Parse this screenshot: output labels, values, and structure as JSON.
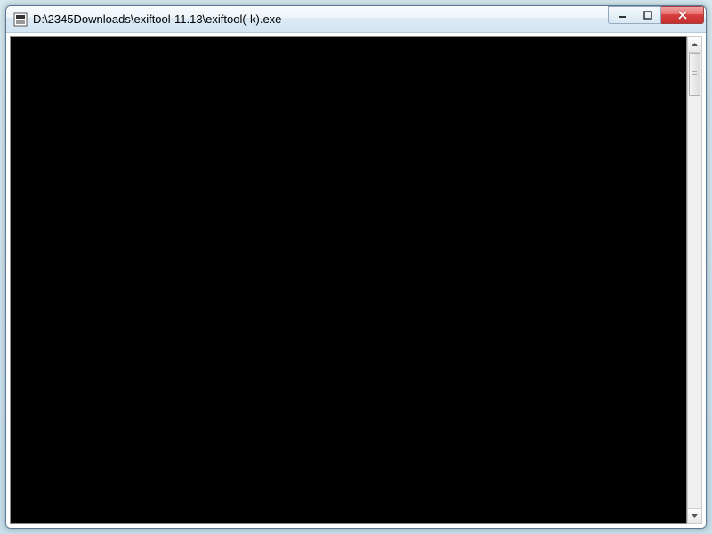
{
  "window": {
    "title": "D:\\2345Downloads\\exiftool-11.13\\exiftool(-k).exe"
  }
}
